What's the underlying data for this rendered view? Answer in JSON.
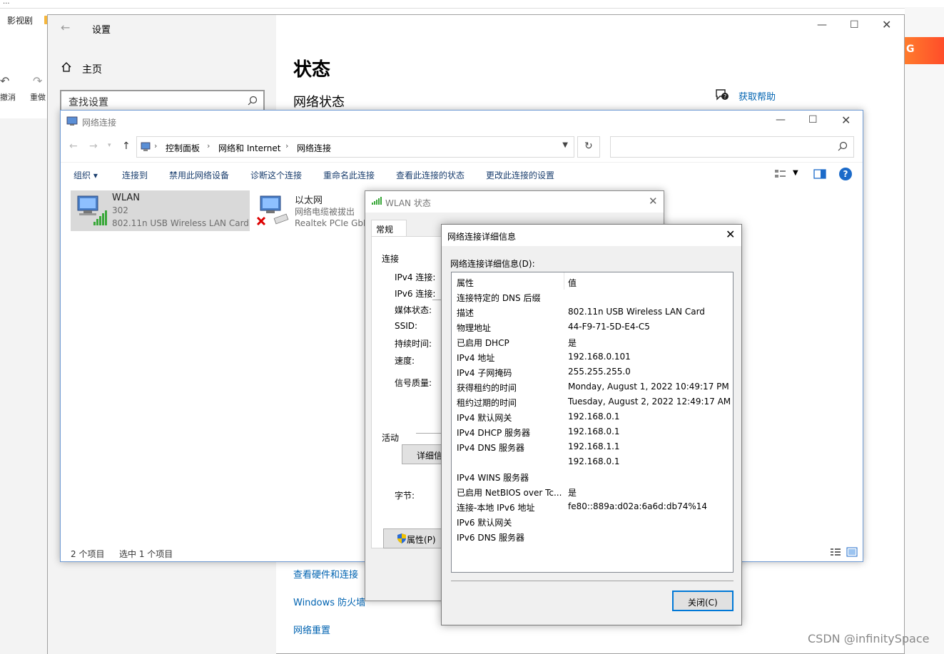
{
  "browser": {
    "bookmark": "影视剧",
    "undo_label": "撤消",
    "redo_label": "重做",
    "banner": "G"
  },
  "settings": {
    "title": "设置",
    "home": "主页",
    "search_placeholder": "查找设置",
    "page_title": "状态",
    "subtitle": "网络状态",
    "help": "获取帮助",
    "link_hardware": "查看硬件和连接",
    "link_firewall": "Windows 防火墙",
    "link_reset": "网络重置"
  },
  "netconn": {
    "title": "网络连接",
    "breadcrumb": [
      "控制面板",
      "网络和 Internet",
      "网络连接"
    ],
    "toolbar": [
      "组织 ▾",
      "连接到",
      "禁用此网络设备",
      "诊断这个连接",
      "重命名此连接",
      "查看此连接的状态",
      "更改此连接的设置"
    ],
    "items": [
      {
        "name": "WLAN",
        "line1": "302",
        "line2": "802.11n USB Wireless LAN Card"
      },
      {
        "name": "以太网",
        "line1": "网络电缆被拔出",
        "line2": "Realtek PCIe GbE"
      }
    ],
    "status_count": "2 个项目",
    "status_selected": "选中 1 个项目"
  },
  "wlan_status": {
    "title": "WLAN 状态",
    "tab": "常规",
    "section_connection": "连接",
    "fields": [
      "IPv4 连接:",
      "IPv6 连接:",
      "媒体状态:",
      "SSID:",
      "持续时间:",
      "速度:",
      "信号质量:"
    ],
    "details_button": "详细信息",
    "section_activity": "活动",
    "bytes_label": "字节:",
    "properties_button": "属性(P)"
  },
  "details": {
    "title": "网络连接详细信息",
    "label": "网络连接详细信息(D):",
    "col_property": "属性",
    "col_value": "值",
    "rows": [
      {
        "prop": "连接特定的 DNS 后缀",
        "val": ""
      },
      {
        "prop": "描述",
        "val": "802.11n USB Wireless LAN Card"
      },
      {
        "prop": "物理地址",
        "val": "44-F9-71-5D-E4-C5"
      },
      {
        "prop": "已启用 DHCP",
        "val": "是"
      },
      {
        "prop": "IPv4 地址",
        "val": "192.168.0.101"
      },
      {
        "prop": "IPv4 子网掩码",
        "val": "255.255.255.0"
      },
      {
        "prop": "获得租约的时间",
        "val": "Monday, August 1, 2022 10:49:17 PM"
      },
      {
        "prop": "租约过期的时间",
        "val": "Tuesday, August 2, 2022 12:49:17 AM"
      },
      {
        "prop": "IPv4 默认网关",
        "val": "192.168.0.1"
      },
      {
        "prop": "IPv4 DHCP 服务器",
        "val": "192.168.0.1"
      },
      {
        "prop": "IPv4 DNS 服务器",
        "val": "192.168.1.1"
      },
      {
        "prop": "",
        "val": "192.168.0.1"
      },
      {
        "prop": "IPv4 WINS 服务器",
        "val": ""
      },
      {
        "prop": "已启用 NetBIOS over Tc...",
        "val": "是"
      },
      {
        "prop": "连接-本地 IPv6 地址",
        "val": "fe80::889a:d02a:6a6d:db74%14"
      },
      {
        "prop": "IPv6 默认网关",
        "val": ""
      },
      {
        "prop": "IPv6 DNS 服务器",
        "val": ""
      }
    ],
    "close_button": "关闭(C)"
  },
  "watermark": "CSDN @infinitySpace"
}
